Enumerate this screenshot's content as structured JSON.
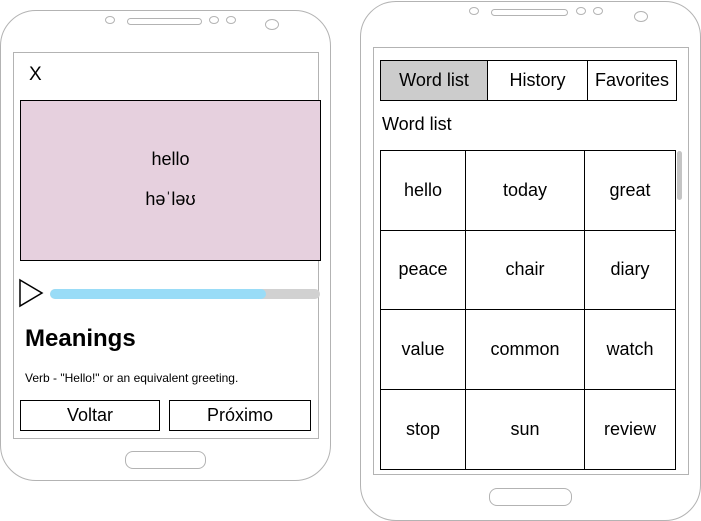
{
  "word_screen": {
    "close_label": "X",
    "word": "hello",
    "phonetic": "həˈləʊ",
    "play_icon": "play-triangle-icon",
    "progress_fraction": 0.8,
    "progress_color": "#99dcf7",
    "card_color": "#e6d0de",
    "meanings_title": "Meanings",
    "meaning_text": "Verb - \"Hello!\" or an equivalent greeting.",
    "back_label": "Voltar",
    "next_label": "Próximo"
  },
  "list_screen": {
    "tabs": [
      {
        "label": "Word list",
        "active": true
      },
      {
        "label": "History",
        "active": false
      },
      {
        "label": "Favorites",
        "active": false
      }
    ],
    "section_title": "Word list",
    "words": [
      [
        "hello",
        "today",
        "great"
      ],
      [
        "peace",
        "chair",
        "diary"
      ],
      [
        "value",
        "common",
        "watch"
      ],
      [
        "stop",
        "sun",
        "review"
      ]
    ]
  }
}
